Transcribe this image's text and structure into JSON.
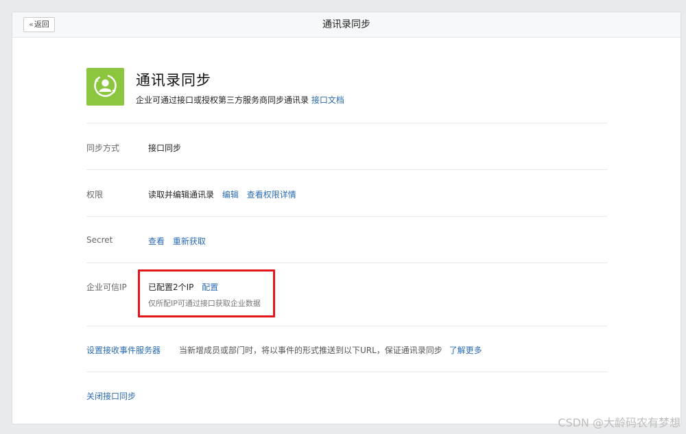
{
  "topbar": {
    "back_label": "返回",
    "title": "通讯录同步"
  },
  "app": {
    "icon": "contacts-sync-icon",
    "title": "通讯录同步",
    "description": "企业可通过接口或授权第三方服务商同步通讯录",
    "doc_link": "接口文档"
  },
  "sync_mode": {
    "label": "同步方式",
    "value": "接口同步"
  },
  "permission": {
    "label": "权限",
    "value": "读取并编辑通讯录",
    "edit_link": "编辑",
    "detail_link": "查看权限详情"
  },
  "secret": {
    "label": "Secret",
    "view_link": "查看",
    "refresh_link": "重新获取"
  },
  "trusted_ip": {
    "label": "企业可信IP",
    "value": "已配置2个IP",
    "config_link": "配置",
    "hint": "仅所配IP可通过接口获取企业数据"
  },
  "event_server": {
    "link": "设置接收事件服务器",
    "description": "当新增成员或部门时，将以事件的形式推送到以下URL，保证通讯录同步",
    "more_link": "了解更多"
  },
  "close_sync": {
    "link": "关闭接口同步"
  },
  "watermark": "CSDN @大龄码农有梦想",
  "colors": {
    "accent_link": "#2a6bb3",
    "icon_bg": "#8cc63f",
    "highlight_box": "#e3141a"
  }
}
